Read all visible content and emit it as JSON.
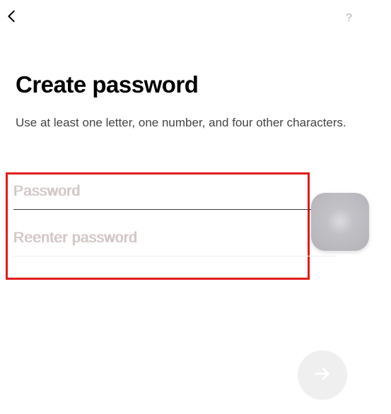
{
  "header": {
    "help_label": "?"
  },
  "page": {
    "title": "Create password",
    "subtitle": "Use at least one letter, one number, and four other characters."
  },
  "form": {
    "password_placeholder": "Password",
    "reenter_placeholder": "Reenter password"
  }
}
